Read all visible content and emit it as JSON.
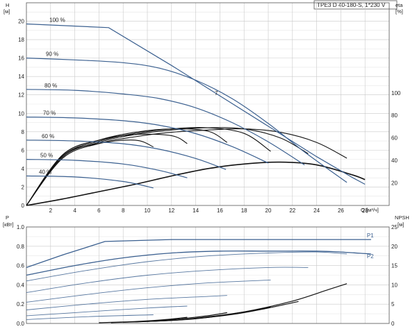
{
  "title_box": "TPE3 D 40-180-S, 1*230 V",
  "colors": {
    "blue": "#3a5f8f",
    "black": "#111111",
    "thin": "#555555",
    "grid": "#c8c8c8",
    "point": "#d0405a"
  },
  "chart_data": [
    {
      "type": "line",
      "name": "pump-curves",
      "y_label": "H",
      "y_unit": "[м]",
      "x_label": "Q",
      "x_unit": "[м³/ч]",
      "y2_label": "eta",
      "y2_unit": "[%]",
      "xlim": [
        0,
        30
      ],
      "ylim": [
        0,
        22
      ],
      "y2lim": [
        0,
        180
      ],
      "x_ticks": [
        "2",
        "4",
        "6",
        "8",
        "10",
        "12",
        "14",
        "16",
        "18",
        "20",
        "22",
        "24",
        "26",
        "28"
      ],
      "y_ticks": [
        "2",
        "4",
        "6",
        "8",
        "10",
        "12",
        "14",
        "16",
        "18",
        "20"
      ],
      "y2_ticks": [
        "20",
        "40",
        "60",
        "80",
        "100"
      ],
      "grid": true,
      "head_curves": [
        {
          "label": "100 %",
          "x": [
            0,
            6.8,
            12,
            16,
            20,
            24,
            27,
            28
          ],
          "y": [
            19.7,
            19.3,
            15.2,
            11.9,
            8.6,
            5.3,
            3.0,
            2.3
          ]
        },
        {
          "label": "90 %",
          "x": [
            0,
            4,
            8,
            11,
            14,
            17,
            20,
            23,
            26.5
          ],
          "y": [
            16,
            15.8,
            15.5,
            14.9,
            13.6,
            11.6,
            8.9,
            5.8,
            2.5
          ]
        },
        {
          "label": "80 %",
          "x": [
            0,
            4,
            8,
            11,
            14,
            17,
            20,
            23
          ],
          "y": [
            12.6,
            12.5,
            12.1,
            11.6,
            10.6,
            9.0,
            6.9,
            4.4
          ]
        },
        {
          "label": "70 %",
          "x": [
            0,
            4,
            8,
            11,
            14,
            17,
            20
          ],
          "y": [
            9.6,
            9.5,
            9.2,
            8.7,
            7.8,
            6.4,
            4.6
          ]
        },
        {
          "label": "60 %",
          "x": [
            0,
            4,
            8,
            11,
            14,
            16.5
          ],
          "y": [
            7.1,
            7.0,
            6.7,
            6.1,
            5.1,
            3.9
          ]
        },
        {
          "label": "50 %",
          "x": [
            0,
            4,
            8,
            11,
            13.3
          ],
          "y": [
            5.0,
            4.9,
            4.5,
            3.8,
            3.0
          ]
        },
        {
          "label": "40 %",
          "x": [
            0,
            4,
            8,
            10.5
          ],
          "y": [
            3.2,
            3.1,
            2.6,
            1.9
          ]
        }
      ],
      "system_curve": {
        "x": [
          0,
          3,
          6,
          9,
          12,
          15,
          18,
          21,
          24,
          27,
          28
        ],
        "y": [
          0,
          0.7,
          1.5,
          2.3,
          3.2,
          4.0,
          4.5,
          4.7,
          4.4,
          3.3,
          2.8
        ]
      },
      "eta_curves": [
        {
          "x": [
            0,
            3,
            6,
            9,
            12,
            15,
            18,
            21,
            24,
            26.5
          ],
          "y": [
            0,
            42,
            55,
            61,
            65,
            67,
            68,
            65,
            56,
            42
          ]
        },
        {
          "x": [
            0,
            3,
            6,
            9,
            12,
            15,
            18,
            21,
            23.3
          ],
          "y": [
            0,
            43,
            56,
            63,
            67,
            69,
            68,
            60,
            46
          ]
        },
        {
          "x": [
            0,
            3,
            6,
            9,
            12,
            15,
            18,
            20.2
          ],
          "y": [
            0,
            44,
            57,
            64,
            68,
            69,
            64,
            48
          ]
        },
        {
          "x": [
            0,
            3,
            6,
            9,
            12,
            15,
            16.6
          ],
          "y": [
            0,
            45,
            58,
            65,
            68,
            66,
            56
          ]
        },
        {
          "x": [
            0,
            3,
            6,
            9,
            12,
            13.3
          ],
          "y": [
            0,
            45,
            58,
            63,
            62,
            55
          ]
        },
        {
          "x": [
            0,
            3,
            6,
            9,
            10.5
          ],
          "y": [
            0,
            44,
            55,
            58,
            52
          ]
        }
      ],
      "duty_point": {
        "x": 15.7,
        "y": 12.2,
        "label": "7"
      }
    },
    {
      "type": "line",
      "name": "power-npsh",
      "y_label": "P",
      "y_unit": "[кВт]",
      "y2_label": "NPSH",
      "y2_unit": "[м]",
      "xlim": [
        0,
        30
      ],
      "ylim": [
        0,
        1.0
      ],
      "y2lim": [
        0,
        25
      ],
      "y_ticks": [
        "0.0",
        "0.2",
        "0.4",
        "0.6",
        "0.8",
        "1.0"
      ],
      "y2_ticks": [
        "0",
        "5",
        "10",
        "15",
        "20",
        "25"
      ],
      "series": [
        {
          "name": "P1",
          "x": [
            0,
            3,
            6.5,
            12,
            20,
            26,
            28.5
          ],
          "y": [
            0.58,
            0.71,
            0.85,
            0.87,
            0.87,
            0.87,
            0.87
          ]
        },
        {
          "name": "P2",
          "x": [
            0,
            4,
            8,
            12,
            16,
            20,
            24,
            26,
            28.5
          ],
          "y": [
            0.5,
            0.6,
            0.68,
            0.73,
            0.75,
            0.75,
            0.75,
            0.74,
            0.72
          ]
        }
      ],
      "power_family": [
        {
          "x": [
            0,
            5,
            10,
            15,
            20,
            24,
            26.5
          ],
          "y": [
            0.44,
            0.55,
            0.64,
            0.7,
            0.73,
            0.74,
            0.72
          ]
        },
        {
          "x": [
            0,
            5,
            10,
            15,
            20,
            23.3
          ],
          "y": [
            0.32,
            0.42,
            0.5,
            0.55,
            0.58,
            0.58
          ]
        },
        {
          "x": [
            0,
            5,
            10,
            15,
            20.2
          ],
          "y": [
            0.22,
            0.3,
            0.37,
            0.42,
            0.45
          ]
        },
        {
          "x": [
            0,
            5,
            10,
            15,
            16.6
          ],
          "y": [
            0.14,
            0.2,
            0.25,
            0.28,
            0.29
          ]
        },
        {
          "x": [
            0,
            5,
            10,
            13.3
          ],
          "y": [
            0.08,
            0.12,
            0.16,
            0.18
          ]
        },
        {
          "x": [
            0,
            5,
            10.5
          ],
          "y": [
            0.04,
            0.07,
            0.09
          ]
        }
      ],
      "npsh_curves": [
        {
          "x": [
            10,
            14,
            18,
            22,
            25,
            26.5
          ],
          "y": [
            0.5,
            1.2,
            3.0,
            5.8,
            8.8,
            10.3
          ]
        },
        {
          "x": [
            9,
            13,
            17,
            20,
            22.5
          ],
          "y": [
            0.4,
            1.0,
            2.3,
            4.0,
            5.7
          ]
        },
        {
          "x": [
            8,
            12,
            15,
            18,
            20.2
          ],
          "y": [
            0.3,
            0.8,
            1.7,
            3.0,
            4.3
          ]
        },
        {
          "x": [
            7,
            10,
            13,
            15,
            16.6
          ],
          "y": [
            0.2,
            0.6,
            1.3,
            2.0,
            2.8
          ]
        },
        {
          "x": [
            6,
            9,
            11.5,
            13.3
          ],
          "y": [
            0.2,
            0.5,
            1.0,
            1.6
          ]
        }
      ]
    }
  ]
}
